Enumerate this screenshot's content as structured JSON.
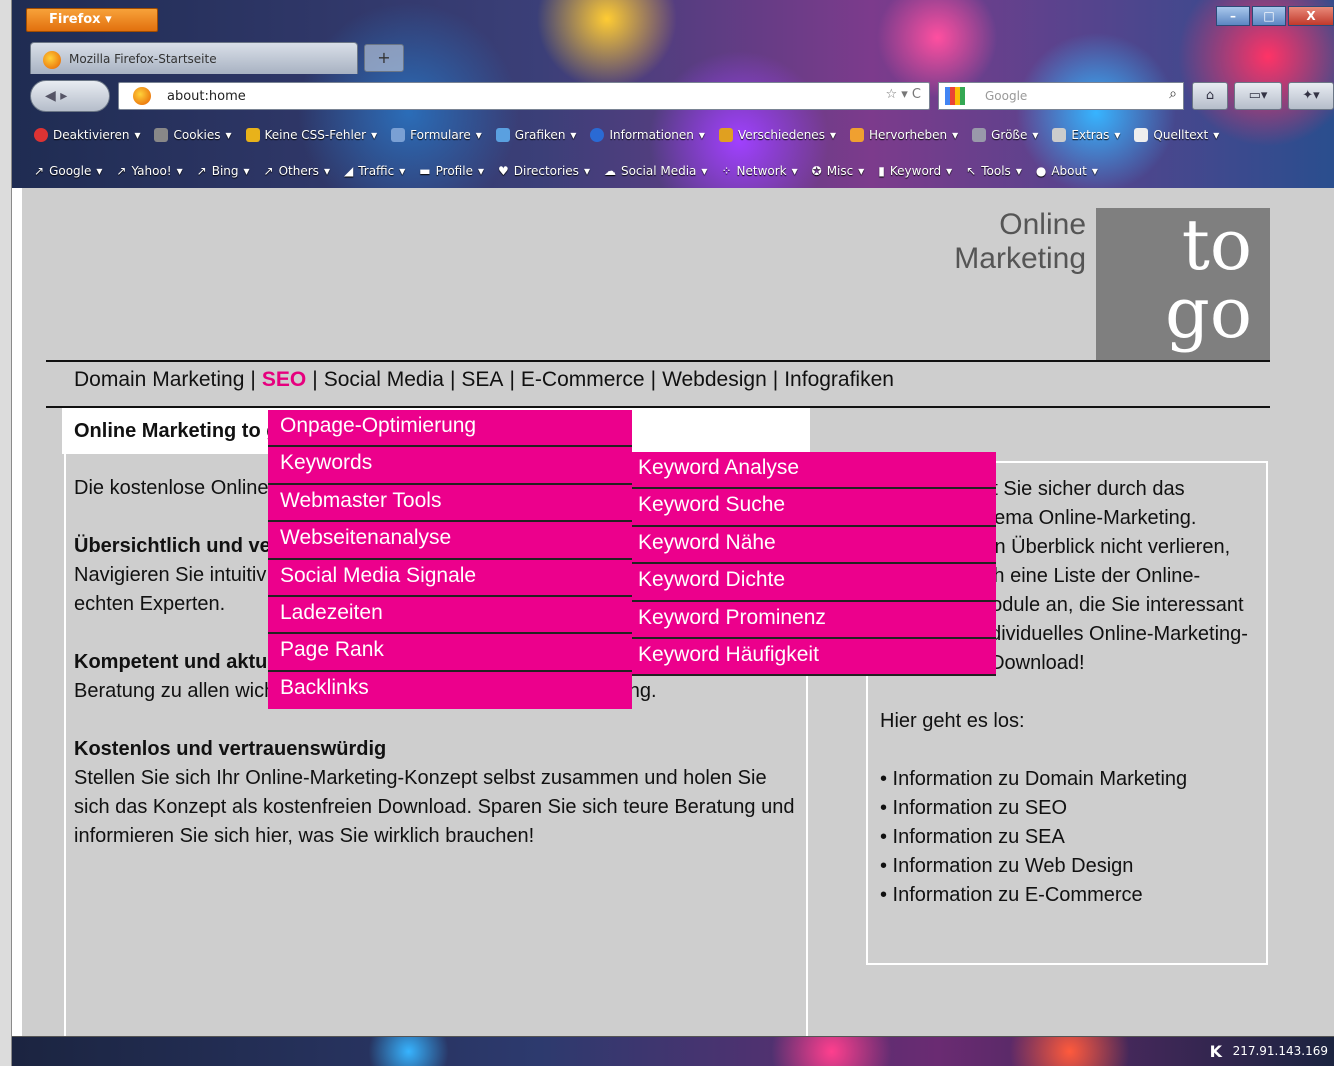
{
  "browser": {
    "menu_button": "Firefox",
    "tab_title": "Mozilla Firefox-Startseite",
    "new_tab": "+",
    "url": "about:home",
    "url_actions": "☆ ▾ C",
    "search_placeholder": "Google",
    "window_controls": [
      "–",
      "□",
      "X"
    ],
    "bookmarks_row1": [
      "Deaktivieren",
      "Cookies",
      "Keine CSS-Fehler",
      "Formulare",
      "Grafiken",
      "Informationen",
      "Verschiedenes",
      "Hervorheben",
      "Größe",
      "Extras",
      "Quelltext"
    ],
    "bookmarks_row2": [
      "Google",
      "Yahoo!",
      "Bing",
      "Others",
      "Traffic",
      "Profile",
      "Directories",
      "Social Media",
      "Network",
      "Misc",
      "Keyword",
      "Tools",
      "About"
    ]
  },
  "logo": {
    "line1": "Online",
    "line2": "Marketing",
    "to": "to",
    "go": "go"
  },
  "nav": {
    "items": [
      "Domain Marketing",
      "SEO",
      "Social Media",
      "SEA",
      "E-Commerce",
      "Webdesign",
      "Infografiken"
    ],
    "separator": "|"
  },
  "left": {
    "heading": "Online Marketing to go",
    "intro": "Die kostenlose Online",
    "sections": [
      {
        "title": "Übersichtlich und verständlich",
        "text": "Navigieren Sie intuitiv durch das Thema Online-Marketing – Sie werden zum echten Experten."
      },
      {
        "title": "Kompetent und aktuell",
        "text": "Beratung zu allen wichtigen Fragestellungen zu Online Marketing."
      },
      {
        "title": "Kostenlos und vertrauenswürdig",
        "text": "Stellen Sie sich Ihr Online-Marketing-Konzept selbst zusammen und holen Sie sich das Konzept als kostenfreien Download. Sparen Sie sich teure Beratung und informieren Sie sich hier, was Sie wirklich brauchen!"
      }
    ]
  },
  "right": {
    "intro": "Hier navigiert Sie sicher durch das komplexe Thema Online-Marketing. Damit Sie den Überblick nicht verlieren, legen Sie sich eine Liste der Online-Marketing-Module an, die Sie interessant finden. Ihr individuelles Online-Marketing-Konzept als Download!",
    "start": "Hier geht es los:",
    "links": [
      "• Information zu Domain Marketing",
      "• Information zu SEO",
      "• Information zu SEA",
      "• Information zu Web Design",
      "• Information zu E-Commerce"
    ]
  },
  "dropdown": {
    "items": [
      "Onpage-Optimierung",
      "Keywords",
      "Webmaster Tools",
      "Webseitenanalyse",
      "Social Media Signale",
      "Ladezeiten",
      "Page Rank",
      "Backlinks"
    ]
  },
  "submenu": {
    "items": [
      "Keyword Analyse",
      "Keyword Suche",
      "Keyword Nähe",
      "Keyword Dichte",
      "Keyword Prominenz",
      "Keyword Häufigkeit"
    ]
  },
  "taskbar": {
    "k": "K",
    "ip": "217.91.143.169"
  },
  "colors": {
    "accent": "#ec008c",
    "page_bg": "#cecece"
  }
}
